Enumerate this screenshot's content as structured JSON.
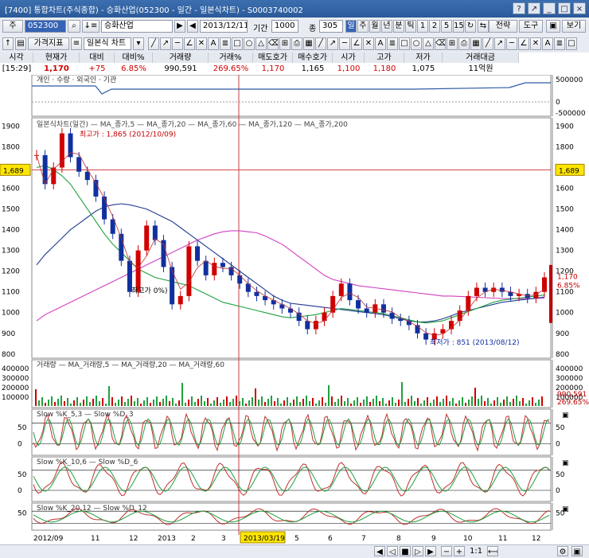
{
  "window": {
    "title": "[7400] 통합차트(주식종합) - 승화산업(052300 - 일간 - 일본식차트) - S0003740002"
  },
  "toolbar1": {
    "type_label": "주",
    "code": "052300",
    "name": "승화산업",
    "date": "2013/12/11",
    "period_label": "기간",
    "period_value": "1000",
    "count_label": "종",
    "count_value": "305",
    "periods": [
      "일",
      "주",
      "월",
      "년",
      "분",
      "틱",
      "1",
      "2",
      "5",
      "15"
    ],
    "right_buttons": [
      "전략",
      "도구",
      "보기"
    ]
  },
  "toolbar2": {
    "indicator_button": "가격지표",
    "chart_type": "일본식 차트"
  },
  "quote": {
    "headers": [
      "시각",
      "현재가",
      "대비",
      "대비%",
      "거래량",
      "거래%",
      "매도호가",
      "매수호가",
      "시가",
      "고가",
      "저가",
      "거래대금"
    ],
    "values": [
      "[15:29]",
      "1,170",
      "+75",
      "6.85%",
      "990,591",
      "269.65%",
      "1,170",
      "1,165",
      "1,100",
      "1,180",
      "1,075",
      "11억원"
    ],
    "colors": [
      "#000",
      "#d00000",
      "#d00000",
      "#d00000",
      "#000",
      "#d00000",
      "#d00000",
      "#000",
      "#d00000",
      "#d00000",
      "#000",
      "#000"
    ]
  },
  "panes": {
    "investor": {
      "legend": "개인 · 수량 · 외국인 · 기관",
      "axis": [
        "500000",
        "0",
        "-500000"
      ]
    },
    "price": {
      "legend": "일본식차트(일간) — MA_종가,5 — MA_종가,20 — MA_종가,60 — MA_종가,120 — MA_종가,200",
      "high_label": "최고가 : 1,865 (2012/10/09)",
      "low_label": "최저가 : 851 (2013/08/12)",
      "mid_label": "최고가 0%)",
      "h_line_value": "1,689",
      "last_price": "1,170",
      "last_change": "6.85%"
    },
    "volume": {
      "legend": "거래량 — MA_거래량,5 — MA_거래량,20 — MA_거래량,60",
      "axis": [
        "400000",
        "300000",
        "200000",
        "100000"
      ],
      "last_volume": "990,591",
      "last_pct": "269.65%"
    },
    "stoch1": {
      "legend": "Slow %K_5,3 — Slow %D_3",
      "axis": [
        "50",
        "0"
      ]
    },
    "stoch2": {
      "legend": "Slow %K_10,6 — Slow %D_6",
      "axis": [
        "50",
        "0"
      ]
    },
    "stoch3": {
      "legend": "Slow %K_20,12 — Slow %D_12",
      "axis": [
        "50"
      ]
    }
  },
  "xaxis": {
    "labels": [
      "2012/09",
      "11",
      "12",
      "2013",
      "2",
      "3",
      "4",
      "5",
      "6",
      "7",
      "8",
      "9",
      "10",
      "11",
      "12"
    ],
    "cursor_date": "2013/03/19"
  },
  "chart_data": {
    "type": "candlestick",
    "y_ticks": [
      800,
      900,
      1000,
      1100,
      1200,
      1300,
      1400,
      1500,
      1600,
      1700,
      1800,
      1900
    ],
    "ylim": [
      780,
      1940
    ],
    "close_series": [
      1760,
      1620,
      1700,
      1865,
      1750,
      1680,
      1640,
      1560,
      1450,
      1380,
      1250,
      1100,
      1300,
      1420,
      1350,
      1220,
      1040,
      1080,
      1320,
      1250,
      1180,
      1240,
      1220,
      1180,
      1140,
      1100,
      1080,
      1060,
      1040,
      1020,
      1000,
      960,
      920,
      960,
      1000,
      1080,
      1140,
      1060,
      1020,
      1000,
      1040,
      1000,
      970,
      960,
      940,
      900,
      870,
      900,
      920,
      960,
      1010,
      1080,
      1120,
      1100,
      1120,
      1100,
      1080,
      1090,
      1070,
      1100,
      1170
    ],
    "ma60_series": [
      1700,
      1710,
      1690,
      1660,
      1620,
      1560,
      1500,
      1440,
      1380,
      1330,
      1290,
      1250,
      1210,
      1190,
      1170,
      1160,
      1150,
      1140,
      1130,
      1110,
      1090,
      1070,
      1050,
      1040,
      1030,
      1020,
      1010,
      1000,
      990,
      980,
      975,
      980,
      985,
      990,
      1000,
      1010,
      1020,
      1015,
      1010,
      1005,
      1000,
      995,
      985,
      975,
      965,
      955,
      950,
      955,
      960,
      975,
      990,
      1005,
      1020,
      1035,
      1050,
      1060,
      1065,
      1070,
      1075,
      1080,
      1085
    ],
    "ma120_series": [
      1230,
      1280,
      1320,
      1360,
      1400,
      1430,
      1460,
      1490,
      1510,
      1520,
      1525,
      1520,
      1510,
      1500,
      1480,
      1460,
      1440,
      1410,
      1380,
      1350,
      1320,
      1290,
      1260,
      1230,
      1200,
      1170,
      1140,
      1110,
      1080,
      1060,
      1045,
      1040,
      1035,
      1030,
      1025,
      1020,
      1015,
      1010,
      1005,
      1000,
      995,
      990,
      980,
      970,
      960,
      955,
      955,
      960,
      970,
      985,
      1000,
      1010,
      1020,
      1030,
      1040,
      1050,
      1055,
      1060,
      1065,
      1070,
      1075
    ],
    "ma200_series": [
      960,
      990,
      1010,
      1030,
      1050,
      1070,
      1090,
      1110,
      1130,
      1150,
      1170,
      1190,
      1210,
      1230,
      1250,
      1270,
      1290,
      1310,
      1330,
      1350,
      1365,
      1380,
      1390,
      1395,
      1395,
      1390,
      1385,
      1370,
      1350,
      1330,
      1300,
      1270,
      1240,
      1210,
      1180,
      1160,
      1150,
      1140,
      1130,
      1125,
      1120,
      1115,
      1110,
      1105,
      1100,
      1095,
      1090,
      1085,
      1080,
      1080,
      1078,
      1076,
      1074,
      1072,
      1070,
      1068,
      1068,
      1067,
      1067,
      1068,
      1070
    ]
  }
}
